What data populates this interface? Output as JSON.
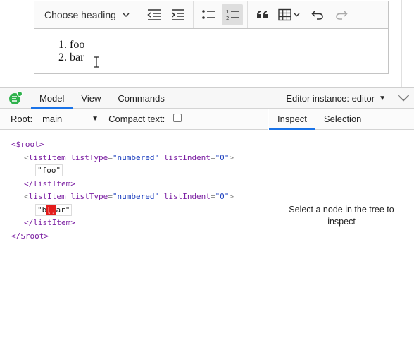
{
  "editor": {
    "heading_dropdown": "Choose heading",
    "list_items": [
      "foo",
      "bar"
    ]
  },
  "inspector": {
    "tabs": [
      "Model",
      "View",
      "Commands"
    ],
    "active_tab": "Model",
    "editor_instance_label": "Editor instance:",
    "editor_instance_value": "editor",
    "root_label": "Root:",
    "root_value": "main",
    "compact_text_label": "Compact text:",
    "right_tabs": [
      "Inspect",
      "Selection"
    ],
    "active_right_tab": "Inspect",
    "inspect_hint": "Select a node in the tree to inspect"
  },
  "tree": {
    "root_open": "<$root>",
    "root_close": "</$root>",
    "items": [
      {
        "tag": "listItem",
        "attrs": [
          {
            "name": "listType",
            "value": "\"numbered\""
          },
          {
            "name": "listIndent",
            "value": "\"0\""
          }
        ],
        "text_before": "\"foo\"",
        "selection": "",
        "text_after": "",
        "close": "</listItem>"
      },
      {
        "tag": "listItem",
        "attrs": [
          {
            "name": "listType",
            "value": "\"numbered\""
          },
          {
            "name": "listIndent",
            "value": "\"0\""
          }
        ],
        "text_before": "\"b",
        "selection": "[]",
        "text_after": "ar\"",
        "close": "</listItem>"
      }
    ]
  },
  "colors": {
    "accent": "#1a73e8",
    "selection": "#e31b1b",
    "logo_green": "#2fb24c",
    "tag_purple": "#7b1fa2",
    "attr_value_blue": "#1c3fbf"
  }
}
